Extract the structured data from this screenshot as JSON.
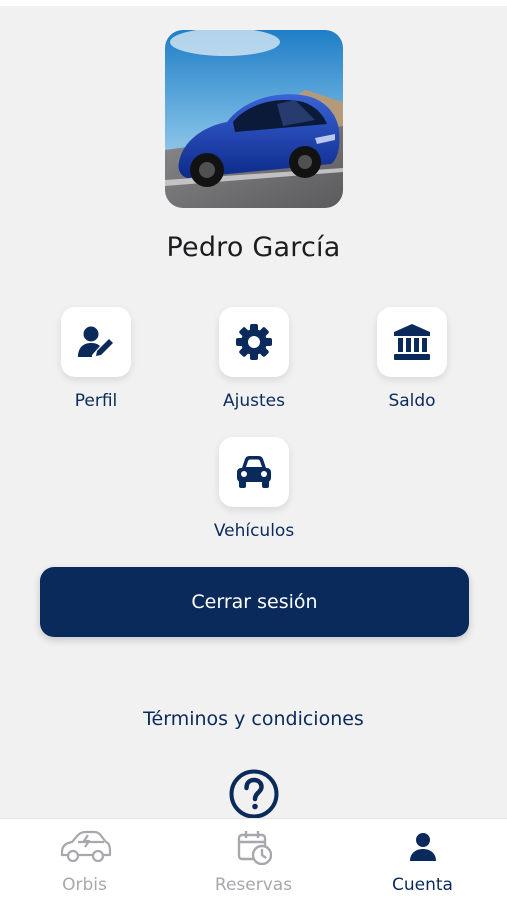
{
  "profile": {
    "name": "Pedro García"
  },
  "menu": [
    {
      "label": "Perfil",
      "icon": "user-edit-icon"
    },
    {
      "label": "Ajustes",
      "icon": "gear-icon"
    },
    {
      "label": "Saldo",
      "icon": "bank-icon"
    },
    {
      "label": "Vehículos",
      "icon": "car-icon"
    }
  ],
  "actions": {
    "logout_label": "Cerrar sesión",
    "terms_label": "Términos y condiciones"
  },
  "tabs": [
    {
      "label": "Orbis",
      "icon": "car-charging-icon",
      "active": false
    },
    {
      "label": "Reservas",
      "icon": "calendar-clock-icon",
      "active": false
    },
    {
      "label": "Cuenta",
      "icon": "user-icon",
      "active": true
    }
  ],
  "colors": {
    "primary": "#0b2a5c",
    "background": "#f1f1f2",
    "inactive": "#a7a8ad"
  }
}
